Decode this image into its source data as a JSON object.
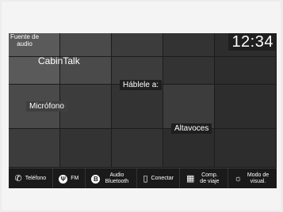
{
  "screen": {
    "clock": "12:34",
    "audio_source_label": "Fuente de audio",
    "panels": {
      "cabintalk": "CabinTalk",
      "speak_to": "Háblele a:",
      "microphone": "Micrófono",
      "speakers": "Altavoces"
    }
  },
  "bottom_bar": {
    "items": [
      {
        "label": "Teléfono",
        "icon": "phone-icon"
      },
      {
        "label": "FM",
        "icon": "antenna-icon"
      },
      {
        "label": "Audio Bluetooth",
        "icon": "bluetooth-icon"
      },
      {
        "label": "Conectar",
        "icon": "smartphone-icon"
      },
      {
        "label": "Comp. de viaje",
        "icon": "fuel-pump-icon"
      },
      {
        "label": "Modo de visual.",
        "icon": "brightness-icon"
      }
    ]
  }
}
